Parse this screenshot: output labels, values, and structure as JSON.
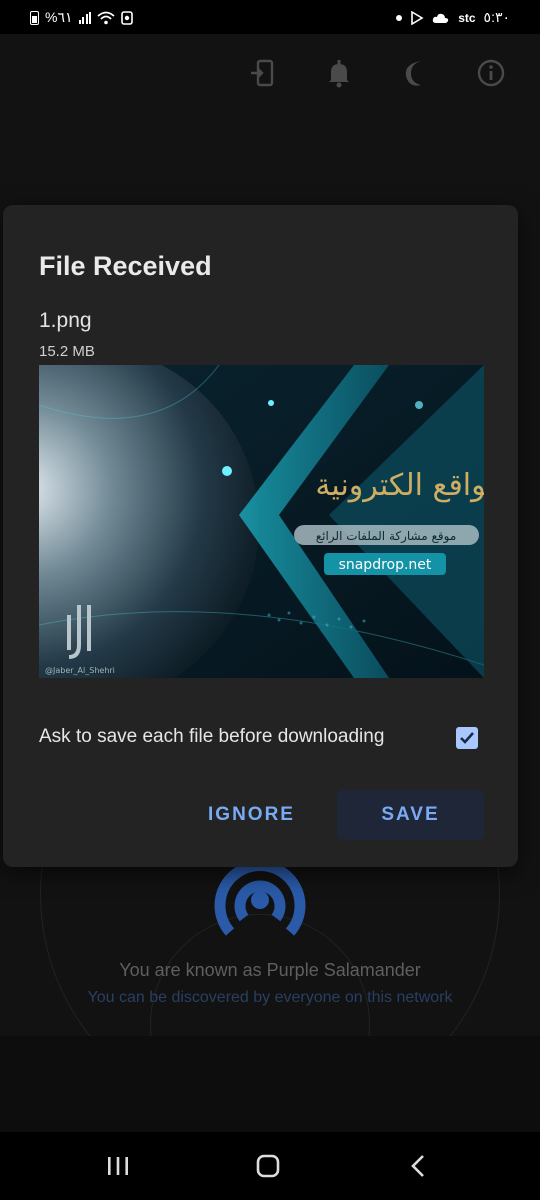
{
  "status_bar": {
    "battery_percent": "%٦١",
    "time": "٥:٣٠",
    "carrier": "stc"
  },
  "toolbar": {
    "icons": [
      "install-app-icon",
      "bell-icon",
      "moon-icon",
      "info-icon"
    ]
  },
  "dialog": {
    "title": "File Received",
    "file_name": "1.png",
    "file_size": "15.2 MB",
    "preview": {
      "arabic_title": "مواقع الكترونية",
      "arabic_subtitle": "موقع مشاركة الملفات الرائع",
      "site_label": "snapdrop.net",
      "handle": "@Jaber_Al_Shehri"
    },
    "ask_label": "Ask to save each file before downloading",
    "ask_checked": true,
    "ignore_label": "IGNORE",
    "save_label": "SAVE"
  },
  "background": {
    "known_as": "You are known as Purple Salamander",
    "discoverable": "You can be discovered by everyone on this network"
  },
  "colors": {
    "accent": "#7aaaf5",
    "checkbox": "#a9c8ff",
    "dialog_bg": "#232323",
    "app_bg": "#121212"
  }
}
